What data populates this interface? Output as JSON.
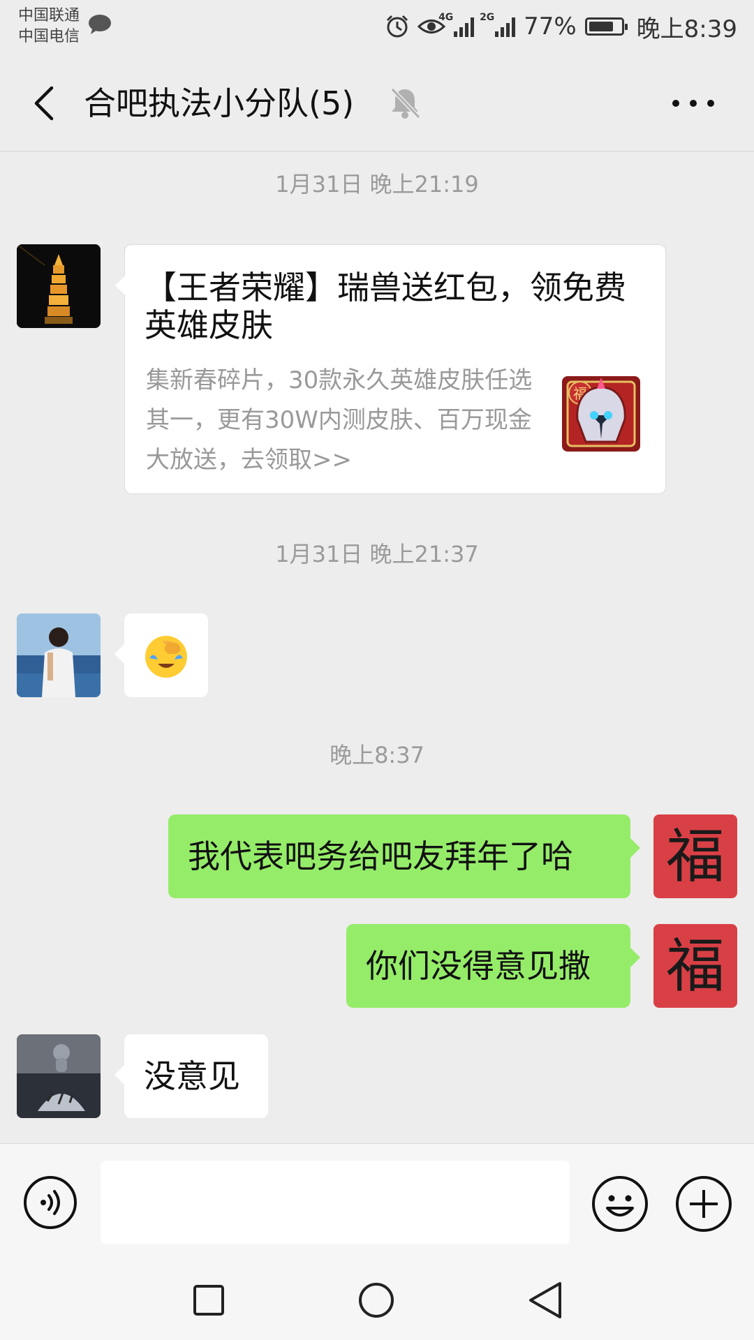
{
  "status_bar": {
    "carrier_1": "中国联通",
    "carrier_2": "中国电信",
    "network_1": "4G",
    "network_2": "2G",
    "battery": "77%",
    "battery_level": 0.77,
    "time": "晚上8:39"
  },
  "header": {
    "title": "合吧执法小分队(5)"
  },
  "messages": {
    "time_1": "1月31日 晚上21:19",
    "card": {
      "title": "【王者荣耀】瑞兽送红包，领免费英雄皮肤",
      "description": "集新春碎片，30款永久英雄皮肤任选其一，更有30W内测皮肤、百万现金大放送，去领取>>",
      "thumb_label": "福"
    },
    "time_2": "1月31日 晚上21:37",
    "emoji": "facepalm-crying-emoji",
    "time_3": "晚上8:37",
    "sent_1": "我代表吧务给吧友拜年了哈",
    "sent_2": "你们没得意见撒",
    "my_avatar_char": "福",
    "reply_1": "没意见"
  },
  "input_bar": {
    "placeholder": ""
  },
  "colors": {
    "background": "#ededed",
    "sent_bubble": "#95ec69",
    "received_bubble": "#ffffff",
    "fu_avatar": "#d94046"
  },
  "icons": {
    "back": "back-arrow-icon",
    "mute": "mute-bell-icon",
    "more": "more-dots-icon",
    "voice": "voice-icon",
    "emoji": "emoji-icon",
    "plus": "plus-icon"
  }
}
